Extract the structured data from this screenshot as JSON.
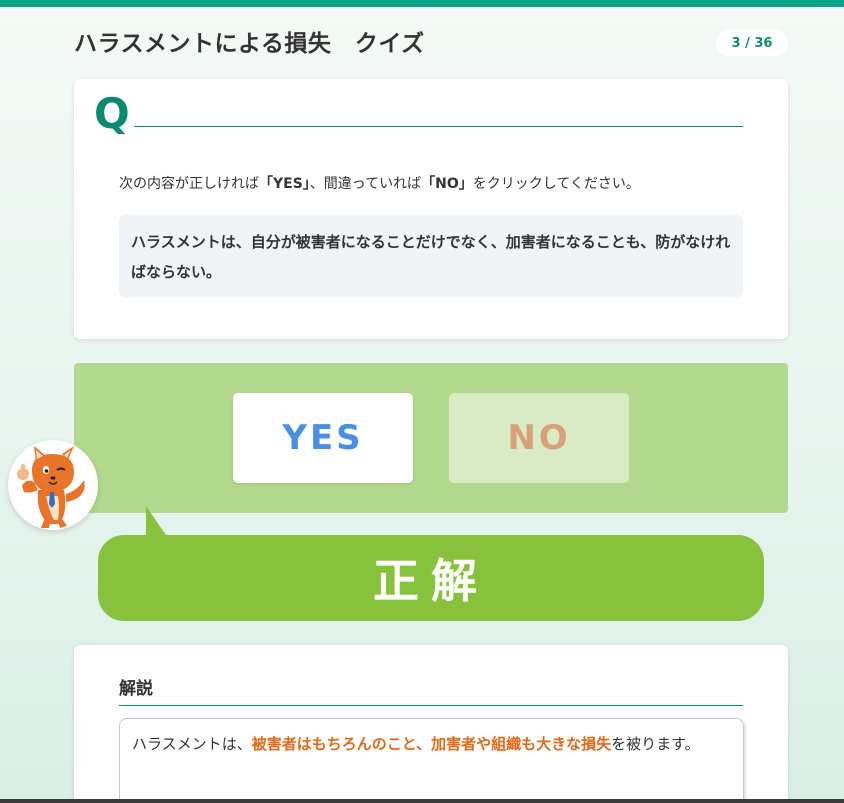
{
  "header": {
    "title": "ハラスメントによる損失　クイズ",
    "progress": "3 / 36"
  },
  "question": {
    "letter": "Q",
    "instruction_parts": [
      "次の内容が正しければ",
      "「YES」",
      "、間違っていれば",
      "「NO」",
      "をクリックしてください。"
    ],
    "statement": "ハラスメントは、自分が被害者になることだけでなく、加害者になることも、防がなければならない。"
  },
  "answers": {
    "yes_label": "YES",
    "no_label": "NO",
    "selected": "YES"
  },
  "result": {
    "label": "正解"
  },
  "explanation": {
    "title": "解説",
    "text_before": "ハラスメントは、",
    "highlight": "被害者はもちろんのこと、加害者や組織も大きな損失",
    "text_after": "を被ります。"
  },
  "colors": {
    "accent": "#0ba58a",
    "answer_panel": "#b2d98d",
    "result_green": "#86c23b",
    "yes_text": "#4a90e2",
    "no_text": "#d9a07c",
    "highlight": "#e06a1b"
  },
  "mascot": {
    "icon": "fox-mascot-thumbs-up-icon"
  }
}
